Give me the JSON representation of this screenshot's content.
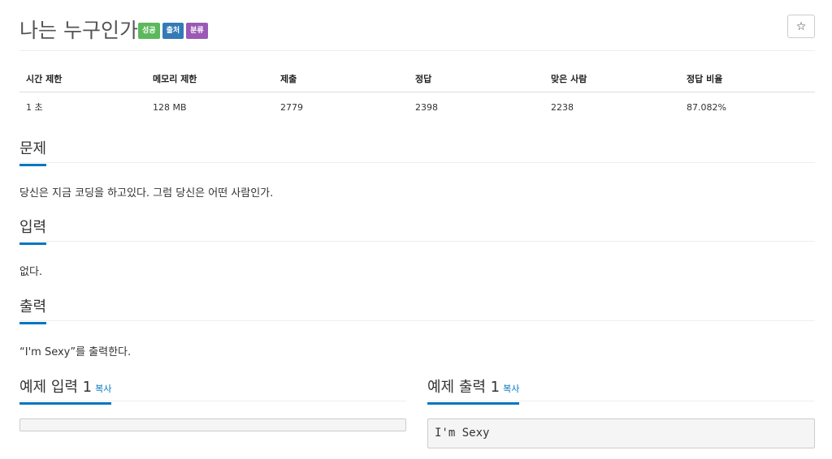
{
  "problem": {
    "title": "나는 누구인가",
    "badges": [
      {
        "label": "성공",
        "color": "#5cb85c"
      },
      {
        "label": "출처",
        "color": "#337ab7"
      },
      {
        "label": "분류",
        "color": "#9b59b6"
      }
    ],
    "star_icon": "star-icon"
  },
  "stats": {
    "headers": [
      "시간 제한",
      "메모리 제한",
      "제출",
      "정답",
      "맞은 사람",
      "정답 비율"
    ],
    "values": [
      "1 초",
      "128 MB",
      "2779",
      "2398",
      "2238",
      "87.082%"
    ]
  },
  "sections": {
    "description": {
      "heading": "문제",
      "text": "당신은 지금 코딩을 하고있다. 그럼 당신은 어떤 사람인가."
    },
    "input": {
      "heading": "입력",
      "text": "없다."
    },
    "output": {
      "heading": "출력",
      "text": "“I'm Sexy”를 출력한다."
    }
  },
  "samples": {
    "input": {
      "heading": "예제 입력 1",
      "copy": "복사",
      "content": ""
    },
    "output": {
      "heading": "예제 출력 1",
      "copy": "복사",
      "content": "I'm Sexy"
    }
  },
  "colors": {
    "accent": "#0076c0"
  }
}
